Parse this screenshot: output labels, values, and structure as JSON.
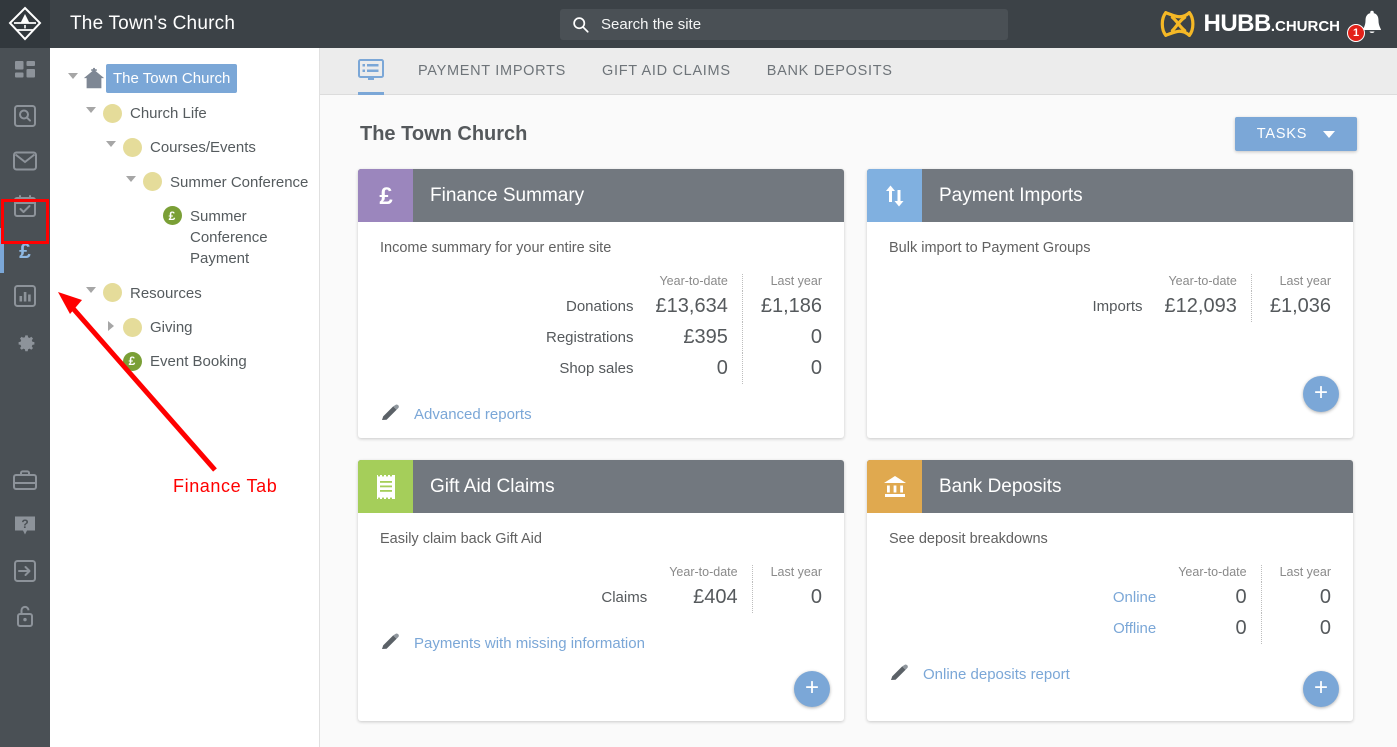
{
  "topbar": {
    "logo_icon": "church-shield-logo",
    "site_title": "The Town's Church",
    "search": {
      "placeholder": "Search the site",
      "value": "",
      "icon": "search-icon"
    },
    "brand": {
      "name": "HUBB",
      "suffix": ".CHURCH",
      "color": "#f5b826"
    },
    "notifications": {
      "icon": "bell-icon",
      "count": "1",
      "badge_color": "#e32119"
    }
  },
  "rail": {
    "items": [
      {
        "name": "dashboard",
        "icon": "dashboard-grid-icon",
        "active": false
      },
      {
        "name": "search",
        "icon": "search-box-icon",
        "active": false
      },
      {
        "name": "messages",
        "icon": "envelope-icon",
        "active": false
      },
      {
        "name": "calendar",
        "icon": "calendar-check-icon",
        "active": false
      },
      {
        "name": "finance",
        "icon": "pound-icon",
        "active": true
      },
      {
        "name": "reports",
        "icon": "bar-chart-icon",
        "active": false
      },
      {
        "name": "settings",
        "icon": "gear-icon",
        "active": false
      }
    ],
    "bottom_items": [
      {
        "name": "briefcase",
        "icon": "briefcase-icon"
      },
      {
        "name": "help",
        "icon": "question-help-icon"
      },
      {
        "name": "signin",
        "icon": "arrow-into-box-icon"
      },
      {
        "name": "unlock",
        "icon": "unlocked-padlock-icon"
      }
    ]
  },
  "tree": {
    "nodes": [
      {
        "label": "The Town Church",
        "icon": "church-home-icon",
        "caret": "down",
        "indent": 0,
        "selected": true
      },
      {
        "label": "Church Life",
        "icon": "yellow-dot",
        "caret": "down",
        "indent": 1,
        "selected": false
      },
      {
        "label": "Courses/Events",
        "icon": "yellow-dot",
        "caret": "down",
        "indent": 2,
        "selected": false
      },
      {
        "label": "Summer Conference",
        "icon": "yellow-dot",
        "caret": "down",
        "indent": 3,
        "selected": false
      },
      {
        "label": "Summer Conference Payment",
        "icon": "green-pound-dot",
        "caret": "none",
        "indent": 4,
        "selected": false
      },
      {
        "label": "Resources",
        "icon": "yellow-dot",
        "caret": "down",
        "indent": 1,
        "selected": false
      },
      {
        "label": "Giving",
        "icon": "yellow-dot",
        "caret": "right",
        "indent": 2,
        "selected": false
      },
      {
        "label": "Event Booking",
        "icon": "green-pound-dot",
        "caret": "none",
        "indent": 2,
        "selected": false
      }
    ]
  },
  "tabs": [
    {
      "label": "",
      "icon": "summary-list-icon",
      "active": true
    },
    {
      "label": "PAYMENT IMPORTS",
      "icon": "",
      "active": false
    },
    {
      "label": "GIFT AID CLAIMS",
      "icon": "",
      "active": false
    },
    {
      "label": "BANK DEPOSITS",
      "icon": "",
      "active": false
    }
  ],
  "page": {
    "title": "The Town Church",
    "tasks_button": {
      "label": "TASKS",
      "icon": "chevron-down-icon",
      "color": "#7ba7d7"
    }
  },
  "columns": {
    "ytd": "Year-to-date",
    "last_year": "Last year"
  },
  "cards": [
    {
      "title": "Finance Summary",
      "icon": "pound-icon",
      "icon_color": "#9b86bd",
      "subtitle": "Income summary for your entire site",
      "rows": [
        {
          "label": "Donations",
          "ytd": "£13,634",
          "last_year": "£1,186",
          "label_link": false
        },
        {
          "label": "Registrations",
          "ytd": "£395",
          "last_year": "0",
          "label_link": false
        },
        {
          "label": "Shop sales",
          "ytd": "0",
          "last_year": "0",
          "label_link": false
        }
      ],
      "link": {
        "label": "Advanced reports",
        "icon": "pencil-icon"
      },
      "fab": false
    },
    {
      "title": "Payment Imports",
      "icon": "up-down-arrows-icon",
      "icon_color": "#80b0e0",
      "subtitle": "Bulk import to Payment Groups",
      "rows": [
        {
          "label": "Imports",
          "ytd": "£12,093",
          "last_year": "£1,036",
          "label_link": false
        }
      ],
      "link": null,
      "fab": true,
      "fab_label": "+"
    },
    {
      "title": "Gift Aid Claims",
      "icon": "receipt-icon",
      "icon_color": "#a5ce5a",
      "subtitle": "Easily claim back Gift Aid",
      "rows": [
        {
          "label": "Claims",
          "ytd": "£404",
          "last_year": "0",
          "label_link": false
        }
      ],
      "link": {
        "label": "Payments with missing information",
        "icon": "pencil-icon"
      },
      "fab": true,
      "fab_label": "+"
    },
    {
      "title": "Bank Deposits",
      "icon": "bank-building-icon",
      "icon_color": "#e0a94f",
      "subtitle": "See deposit breakdowns",
      "rows": [
        {
          "label": "Online",
          "ytd": "0",
          "last_year": "0",
          "label_link": true
        },
        {
          "label": "Offline",
          "ytd": "0",
          "last_year": "0",
          "label_link": true
        }
      ],
      "link": {
        "label": "Online deposits report",
        "icon": "pencil-icon"
      },
      "fab": true,
      "fab_label": "+"
    }
  ],
  "annotation": {
    "label": "Finance Tab",
    "color": "#ff0000"
  }
}
